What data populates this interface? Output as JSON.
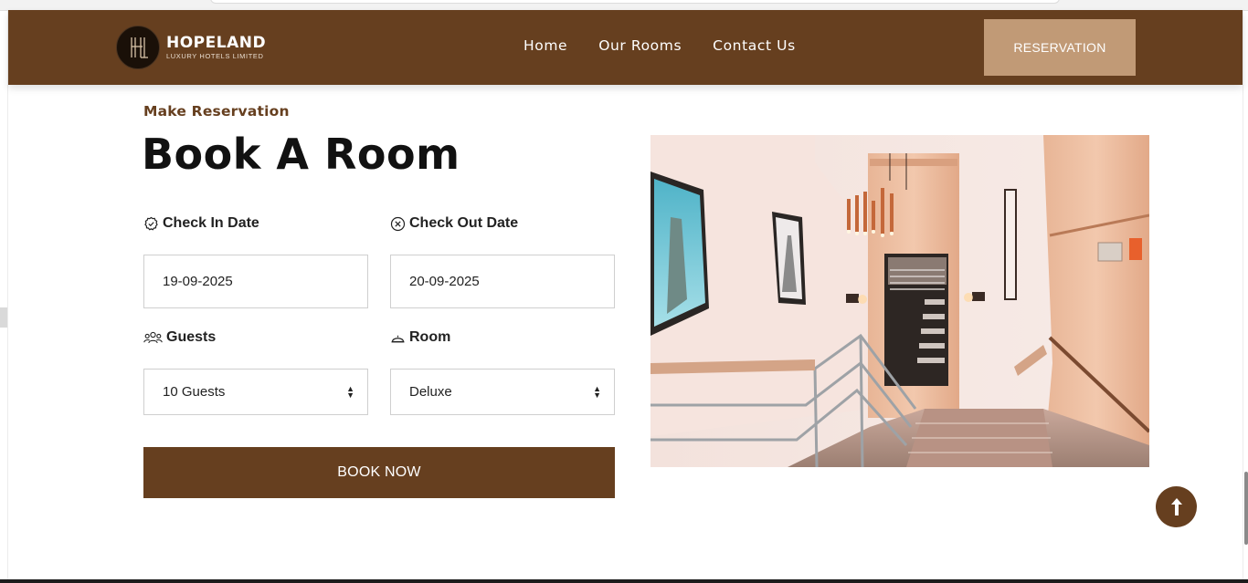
{
  "brand": {
    "name": "HOPELAND",
    "tagline": "LUXURY HOTELS LIMITED",
    "logo_icon": "hl-monogram-icon"
  },
  "nav": {
    "links": [
      {
        "label": "Home"
      },
      {
        "label": "Our Rooms"
      },
      {
        "label": "Contact Us"
      }
    ],
    "cta_label": "RESERVATION"
  },
  "booking": {
    "eyebrow": "Make Reservation",
    "title": "Book A Room",
    "check_in": {
      "label": "Check In Date",
      "value": "19-09-2025",
      "icon": "check-circle-icon"
    },
    "check_out": {
      "label": "Check Out Date",
      "value": "20-09-2025",
      "icon": "x-circle-icon"
    },
    "guests": {
      "label": "Guests",
      "value": "10 Guests",
      "icon": "users-icon"
    },
    "room": {
      "label": "Room",
      "value": "Deluxe",
      "icon": "room-service-bell-icon"
    },
    "submit_label": "BOOK NOW"
  },
  "photo": {
    "icon": "hotel-staircase-photo"
  },
  "scroll_top": {
    "icon": "arrow-up-icon"
  },
  "colors": {
    "brand_brown": "#663f1f",
    "accent_tan": "#c19a76"
  }
}
